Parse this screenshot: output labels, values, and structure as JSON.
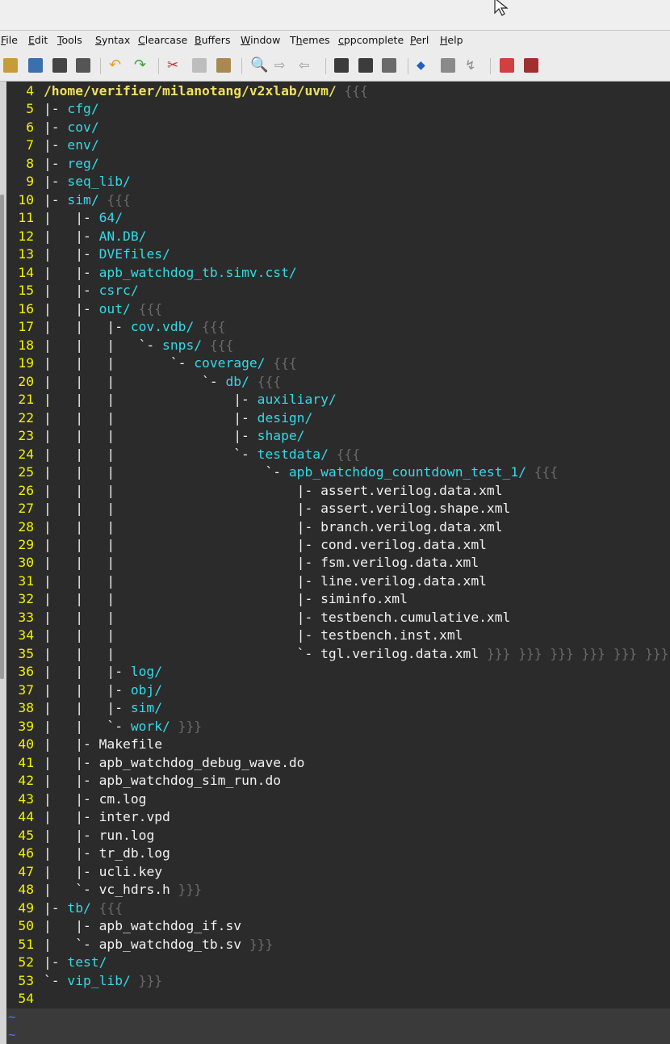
{
  "menu": {
    "items": [
      {
        "pre": "",
        "u": "F",
        "post": "ile"
      },
      {
        "pre": "",
        "u": "E",
        "post": "dit"
      },
      {
        "pre": "",
        "u": "T",
        "post": "ools"
      },
      {
        "pre": "",
        "u": "S",
        "post": "yntax"
      },
      {
        "pre": "",
        "u": "C",
        "post": "learcase"
      },
      {
        "pre": "",
        "u": "B",
        "post": "uffers"
      },
      {
        "pre": "",
        "u": "W",
        "post": "indow"
      },
      {
        "pre": "T",
        "u": "h",
        "post": "emes"
      },
      {
        "pre": "",
        "u": "c",
        "post": "ppcomplete"
      },
      {
        "pre": "",
        "u": "P",
        "post": "erl"
      },
      {
        "pre": "",
        "u": "H",
        "post": "elp"
      }
    ]
  },
  "colors": {
    "line_number": "#f2f200",
    "directory": "#35d9e6",
    "root_path": "#f0e060",
    "file": "#f1f1f1",
    "fold_marker": "#6a6a6a",
    "tilde": "#4f6fff"
  },
  "lines": [
    {
      "n": "4",
      "tree": "",
      "text": "/home/verifier/milanotang/v2xlab/uvm/",
      "kind": "root",
      "fold": " {{{"
    },
    {
      "n": "5",
      "tree": "|- ",
      "text": "cfg/",
      "kind": "dir",
      "fold": ""
    },
    {
      "n": "6",
      "tree": "|- ",
      "text": "cov/",
      "kind": "dir",
      "fold": ""
    },
    {
      "n": "7",
      "tree": "|- ",
      "text": "env/",
      "kind": "dir",
      "fold": ""
    },
    {
      "n": "8",
      "tree": "|- ",
      "text": "reg/",
      "kind": "dir",
      "fold": ""
    },
    {
      "n": "9",
      "tree": "|- ",
      "text": "seq_lib/",
      "kind": "dir",
      "fold": ""
    },
    {
      "n": "10",
      "tree": "|- ",
      "text": "sim/",
      "kind": "dir",
      "fold": " {{{"
    },
    {
      "n": "11",
      "tree": "|   |- ",
      "text": "64/",
      "kind": "dir",
      "fold": ""
    },
    {
      "n": "12",
      "tree": "|   |- ",
      "text": "AN.DB/",
      "kind": "dir",
      "fold": ""
    },
    {
      "n": "13",
      "tree": "|   |- ",
      "text": "DVEfiles/",
      "kind": "dir",
      "fold": ""
    },
    {
      "n": "14",
      "tree": "|   |- ",
      "text": "apb_watchdog_tb.simv.cst/",
      "kind": "dir",
      "fold": ""
    },
    {
      "n": "15",
      "tree": "|   |- ",
      "text": "csrc/",
      "kind": "dir",
      "fold": ""
    },
    {
      "n": "16",
      "tree": "|   |- ",
      "text": "out/",
      "kind": "dir",
      "fold": " {{{"
    },
    {
      "n": "17",
      "tree": "|   |   |- ",
      "text": "cov.vdb/",
      "kind": "dir",
      "fold": " {{{"
    },
    {
      "n": "18",
      "tree": "|   |   |   `- ",
      "text": "snps/",
      "kind": "dir",
      "fold": " {{{"
    },
    {
      "n": "19",
      "tree": "|   |   |       `- ",
      "text": "coverage/",
      "kind": "dir",
      "fold": " {{{"
    },
    {
      "n": "20",
      "tree": "|   |   |           `- ",
      "text": "db/",
      "kind": "dir",
      "fold": " {{{"
    },
    {
      "n": "21",
      "tree": "|   |   |               |- ",
      "text": "auxiliary/",
      "kind": "dir",
      "fold": ""
    },
    {
      "n": "22",
      "tree": "|   |   |               |- ",
      "text": "design/",
      "kind": "dir",
      "fold": ""
    },
    {
      "n": "23",
      "tree": "|   |   |               |- ",
      "text": "shape/",
      "kind": "dir",
      "fold": ""
    },
    {
      "n": "24",
      "tree": "|   |   |               `- ",
      "text": "testdata/",
      "kind": "dir",
      "fold": " {{{"
    },
    {
      "n": "25",
      "tree": "|   |   |                   `- ",
      "text": "apb_watchdog_countdown_test_1/",
      "kind": "dir",
      "fold": " {{{"
    },
    {
      "n": "26",
      "tree": "|   |   |                       |- ",
      "text": "assert.verilog.data.xml",
      "kind": "file",
      "fold": ""
    },
    {
      "n": "27",
      "tree": "|   |   |                       |- ",
      "text": "assert.verilog.shape.xml",
      "kind": "file",
      "fold": ""
    },
    {
      "n": "28",
      "tree": "|   |   |                       |- ",
      "text": "branch.verilog.data.xml",
      "kind": "file",
      "fold": ""
    },
    {
      "n": "29",
      "tree": "|   |   |                       |- ",
      "text": "cond.verilog.data.xml",
      "kind": "file",
      "fold": ""
    },
    {
      "n": "30",
      "tree": "|   |   |                       |- ",
      "text": "fsm.verilog.data.xml",
      "kind": "file",
      "fold": ""
    },
    {
      "n": "31",
      "tree": "|   |   |                       |- ",
      "text": "line.verilog.data.xml",
      "kind": "file",
      "fold": ""
    },
    {
      "n": "32",
      "tree": "|   |   |                       |- ",
      "text": "siminfo.xml",
      "kind": "file",
      "fold": ""
    },
    {
      "n": "33",
      "tree": "|   |   |                       |- ",
      "text": "testbench.cumulative.xml",
      "kind": "file",
      "fold": ""
    },
    {
      "n": "34",
      "tree": "|   |   |                       |- ",
      "text": "testbench.inst.xml",
      "kind": "file",
      "fold": ""
    },
    {
      "n": "35",
      "tree": "|   |   |                       `- ",
      "text": "tgl.verilog.data.xml",
      "kind": "file",
      "fold": " }}} }}} }}} }}} }}} }}}"
    },
    {
      "n": "36",
      "tree": "|   |   |- ",
      "text": "log/",
      "kind": "dir",
      "fold": ""
    },
    {
      "n": "37",
      "tree": "|   |   |- ",
      "text": "obj/",
      "kind": "dir",
      "fold": ""
    },
    {
      "n": "38",
      "tree": "|   |   |- ",
      "text": "sim/",
      "kind": "dir",
      "fold": ""
    },
    {
      "n": "39",
      "tree": "|   |   `- ",
      "text": "work/",
      "kind": "dir",
      "fold": " }}}"
    },
    {
      "n": "40",
      "tree": "|   |- ",
      "text": "Makefile",
      "kind": "file",
      "fold": ""
    },
    {
      "n": "41",
      "tree": "|   |- ",
      "text": "apb_watchdog_debug_wave.do",
      "kind": "file",
      "fold": ""
    },
    {
      "n": "42",
      "tree": "|   |- ",
      "text": "apb_watchdog_sim_run.do",
      "kind": "file",
      "fold": ""
    },
    {
      "n": "43",
      "tree": "|   |- ",
      "text": "cm.log",
      "kind": "file",
      "fold": ""
    },
    {
      "n": "44",
      "tree": "|   |- ",
      "text": "inter.vpd",
      "kind": "file",
      "fold": ""
    },
    {
      "n": "45",
      "tree": "|   |- ",
      "text": "run.log",
      "kind": "file",
      "fold": ""
    },
    {
      "n": "46",
      "tree": "|   |- ",
      "text": "tr_db.log",
      "kind": "file",
      "fold": ""
    },
    {
      "n": "47",
      "tree": "|   |- ",
      "text": "ucli.key",
      "kind": "file",
      "fold": ""
    },
    {
      "n": "48",
      "tree": "|   `- ",
      "text": "vc_hdrs.h",
      "kind": "file",
      "fold": " }}}"
    },
    {
      "n": "49",
      "tree": "|- ",
      "text": "tb/",
      "kind": "dir",
      "fold": " {{{"
    },
    {
      "n": "50",
      "tree": "|   |- ",
      "text": "apb_watchdog_if.sv",
      "kind": "file",
      "fold": ""
    },
    {
      "n": "51",
      "tree": "|   `- ",
      "text": "apb_watchdog_tb.sv",
      "kind": "file",
      "fold": " }}}"
    },
    {
      "n": "52",
      "tree": "|- ",
      "text": "test/",
      "kind": "dir",
      "fold": ""
    },
    {
      "n": "53",
      "tree": "`- ",
      "text": "vip_lib/",
      "kind": "dir",
      "fold": " }}}"
    },
    {
      "n": "54",
      "tree": "",
      "text": "",
      "kind": "file",
      "fold": ""
    }
  ],
  "tildes": [
    "~",
    "~"
  ]
}
